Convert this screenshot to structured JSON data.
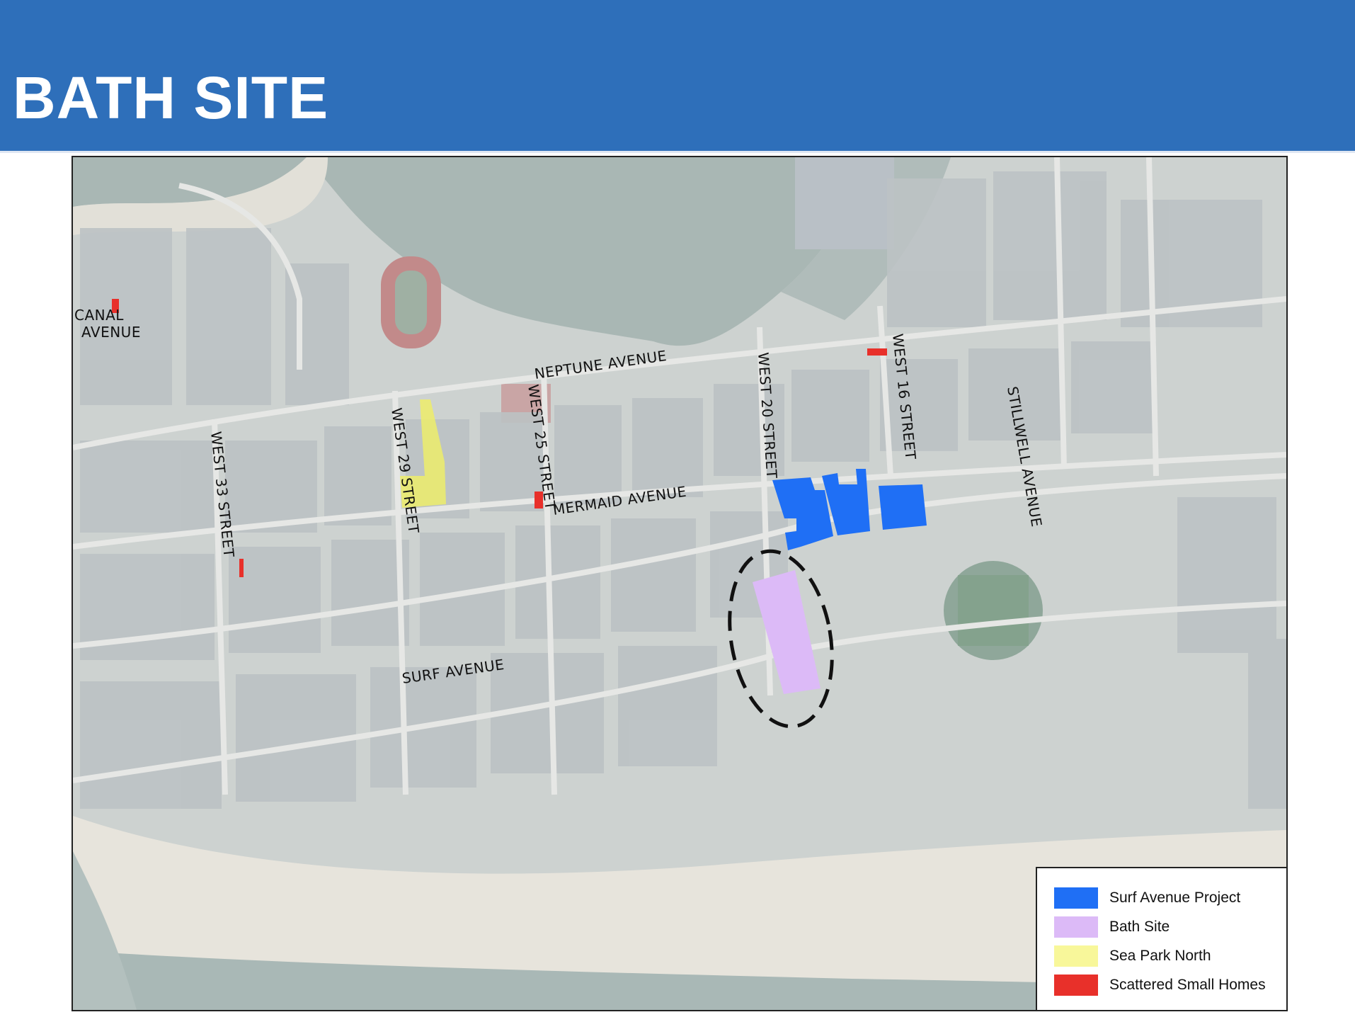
{
  "header": {
    "title": "BATH SITE",
    "background_color": "#2e6fba"
  },
  "map": {
    "streets": {
      "canal_line1": "CANAL",
      "canal_line2": "AVENUE",
      "neptune": "NEPTUNE AVENUE",
      "mermaid": "MERMAID AVENUE",
      "surf": "SURF AVENUE",
      "west_33": "WEST 33 STREET",
      "west_29": "WEST 29 STREET",
      "west_25": "WEST 25 STREET",
      "west_20": "WEST 20 STREET",
      "west_16": "WEST 16 STREET",
      "stillwell": "STILLWELL AVENUE"
    },
    "colors": {
      "surf_avenue_project": "#1f6ff5",
      "bath_site": "#dcbaf7",
      "sea_park_north": "#eded6a",
      "scattered_small_homes": "#e8302a"
    }
  },
  "legend": {
    "items": [
      {
        "label": "Surf Avenue Project",
        "color": "#1f6ff5"
      },
      {
        "label": "Bath Site",
        "color": "#dcbaf7"
      },
      {
        "label": "Sea Park North",
        "color": "#f8f79a"
      },
      {
        "label": "Scattered Small Homes",
        "color": "#e8302a"
      }
    ]
  }
}
